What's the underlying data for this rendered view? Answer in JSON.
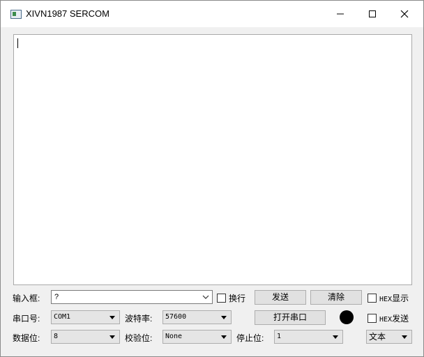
{
  "window": {
    "title": "XIVN1987 SERCOM"
  },
  "titlebar_buttons": {
    "minimize": "—",
    "maximize": "☐",
    "close": "✕"
  },
  "input_row": {
    "label": "输入框:",
    "value": "?",
    "newline_label": "换行",
    "send_label": "发送",
    "clear_label": "清除",
    "hex_display_prefix": "HEX",
    "hex_display_suffix": "显示"
  },
  "port_row": {
    "port_label": "串口号:",
    "port_value": "COM1",
    "baud_label": "波特率:",
    "baud_value": "57600",
    "open_label": "打开串口",
    "hex_send_prefix": "HEX",
    "hex_send_suffix": "发送"
  },
  "data_row": {
    "databits_label": "数据位:",
    "databits_value": "8",
    "parity_label": "校验位:",
    "parity_value": "None",
    "stopbits_label": "停止位:",
    "stopbits_value": "1",
    "mode_value": "文本"
  },
  "colors": {
    "led": "#000000"
  }
}
